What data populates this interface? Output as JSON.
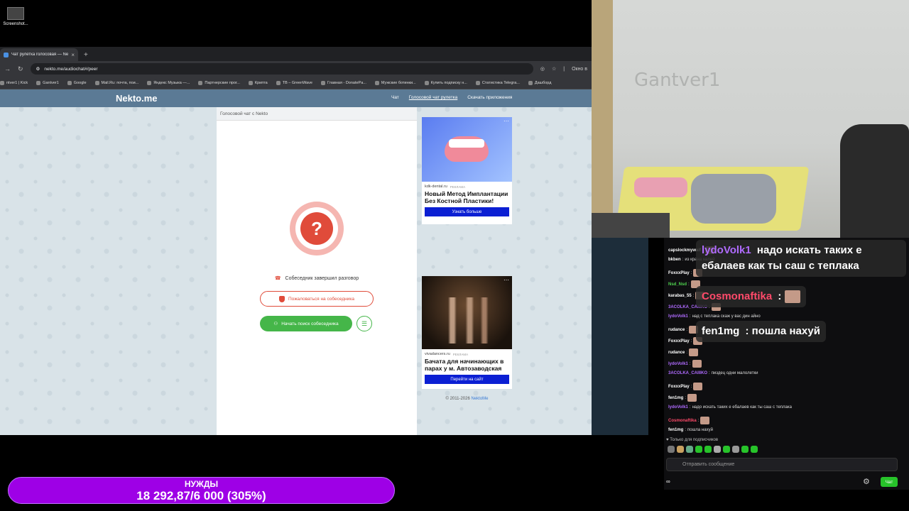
{
  "desktop": {
    "icon_label": "Screenshot..."
  },
  "browser": {
    "tab_title": "Чат рулетка голосовая — Nekt",
    "url": "nekto.me/audiochat#/peer",
    "url_right": "Окно в",
    "bookmarks": [
      "ntver1 | Kick",
      "Gantver1",
      "Google",
      "Mail.Ru: почта, пои...",
      "Яндекс Музыка —...",
      "Партнерские прог...",
      "Крипта",
      "TB – GreenWave",
      "Главная - DonatePa...",
      "Мужские ботинки...",
      "Купить подписку н...",
      "Статистика Telegra...",
      "Дашборд"
    ]
  },
  "site": {
    "logo": "Nekto.me",
    "nav": [
      "Чат",
      "Голосовой чат рулетка",
      "Скачать приложения"
    ],
    "chat_header": "Голосовой чат с Nekto",
    "question_mark": "?",
    "ended_text": "Собеседник завершил разговор",
    "report_label": "Пожаловаться на собеседника",
    "search_label": "Начать поиск собеседника",
    "ad1": {
      "source": "kdk-dental.ru",
      "tag": "РЕКЛАМА",
      "title": "Новый Метод Имплантации Без Костной Пластики!",
      "button": "Узнать больше"
    },
    "ad2": {
      "source": "vivadancers.ru",
      "tag": "РЕКЛАМА",
      "title": "Бачата для начинающих в парах у м. Автозаводская",
      "button": "Перейти на сайт"
    },
    "copyright": "© 2011-2026",
    "copyright_link": "NektoMe"
  },
  "webcam": {
    "wall_text": "Gantver1"
  },
  "chat": {
    "lines": [
      {
        "user": "capslockmywaif",
        "text": "",
        "color": "#ffffff"
      },
      {
        "user": "bkben",
        "text": "из крана налей",
        "color": "#ffffff"
      },
      {
        "user": "FoxxxPlay",
        "text": "",
        "color": "#ffffff"
      },
      {
        "user": "Nsd_Nsd",
        "text": "",
        "color": "#4fd34f"
      },
      {
        "user": "karabas_55",
        "text": "",
        "color": "#ffffff"
      },
      {
        "user": "3ACOLKA_CAIIIKO",
        "text": "",
        "color": "#b06bff"
      },
      {
        "user": "lydoVolk1",
        "text": "над с теплака скаж у вас дин айно",
        "color": "#b06bff"
      },
      {
        "user": "rudance",
        "text": "",
        "color": "#ffffff"
      },
      {
        "user": "FoxxxPlay",
        "text": "",
        "color": "#ffffff"
      },
      {
        "user": "rudance",
        "text": "",
        "color": "#ffffff"
      },
      {
        "user": "lydoVolk1",
        "text": "",
        "color": "#b06bff"
      },
      {
        "user": "3ACOLKA_CAIIIKO",
        "text": "пиздец одни малолетки",
        "color": "#b06bff"
      },
      {
        "user": "FoxxxPlay",
        "text": "",
        "color": "#ffffff"
      },
      {
        "user": "fen1mg",
        "text": "",
        "color": "#ffffff"
      },
      {
        "user": "lydoVolk1",
        "text": "надо искать таких е ебалаев как ты саш с теплака",
        "color": "#b06bff"
      },
      {
        "user": "Cosmonaftika",
        "text": "",
        "color": "#ff4a6a"
      },
      {
        "user": "fen1mg",
        "text": "пошла нахуй",
        "color": "#ffffff"
      }
    ],
    "big": [
      {
        "user": "lydoVolk1",
        "text": "надо искать таких е ебалаев как ты саш с теплака",
        "color": "#b06bff"
      },
      {
        "user": "Cosmonaftika",
        "text": ":",
        "color": "#ff4a6a"
      },
      {
        "user": "fen1mg",
        "text": ": пошла нахуй",
        "color": "#ffffff"
      }
    ],
    "subs_note": "Только для подписчиков",
    "input_placeholder": "Отправить сообщение",
    "send_label": "Чат",
    "points": "∞"
  },
  "goal": {
    "title": "НУЖДЫ",
    "value": "18 292,87/6 000 (305%)"
  },
  "colors": {
    "accent_green": "#45b649",
    "danger": "#e04b3a",
    "goal_purple": "#9e00e6",
    "site_header": "#5b7a95"
  }
}
